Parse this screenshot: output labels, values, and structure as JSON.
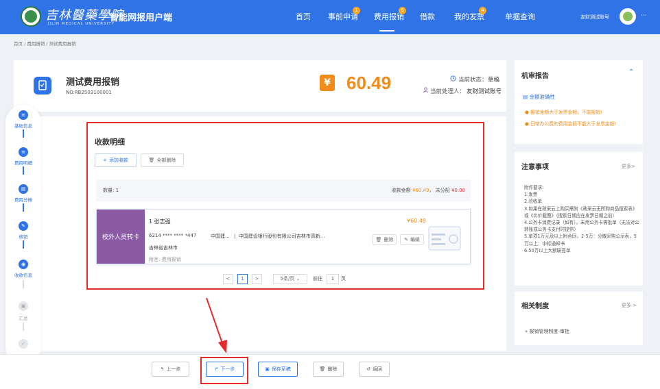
{
  "header": {
    "brand_cn": "吉林醫藥學院",
    "brand_en": "JILIN MEDICAL UNIVERSITY",
    "app_title": "智能网报用户端",
    "nav": [
      {
        "label": "首页",
        "badge": ""
      },
      {
        "label": "事前申请",
        "badge": "1"
      },
      {
        "label": "费用报销",
        "badge": "6"
      },
      {
        "label": "借款",
        "badge": ""
      },
      {
        "label": "我的发票",
        "badge": "4"
      },
      {
        "label": "单据查询",
        "badge": ""
      }
    ],
    "user_name": "友财测试账号",
    "more": "···"
  },
  "breadcrumb": "首页 / 费用报销 / 测试费用报销",
  "document": {
    "title": "测试费用报销",
    "number": "NO.RB2503100001",
    "amount": "60.49",
    "amount_icon": "¥",
    "status_label": "当前状态：",
    "status_value": "草稿",
    "handler_label": "当前处理人：",
    "handler_value": "友财测试账号"
  },
  "steps": [
    {
      "label": "基础信息",
      "active": true,
      "icon": "doc-icon"
    },
    {
      "label": "费用明细",
      "active": true,
      "icon": "list-icon"
    },
    {
      "label": "费用分摊",
      "active": true,
      "icon": "split-icon"
    },
    {
      "label": "核销",
      "active": true,
      "icon": "verify-icon"
    },
    {
      "label": "收款信息",
      "active": true,
      "icon": "payee-icon"
    },
    {
      "label": "汇总",
      "active": false,
      "icon": "summary-icon"
    },
    {
      "label": "完成",
      "active": false,
      "icon": "check-icon"
    }
  ],
  "payee_section": {
    "title": "收款明细",
    "add_button": "添加收款",
    "delete_all_button": "全部删除",
    "count_text": "数量: 1",
    "summary_amount_label": "收款金额",
    "summary_amount": "¥60.49",
    "unallocated_label": "未分配",
    "unallocated_amount": "¥0.00",
    "card": {
      "stamp": "校外人员转卡",
      "index_name": "1  张志强",
      "account": "6214 **** **** *447",
      "bank_short": "中国建...",
      "bank_full": "中国建设银行股份有限公司吉林市高新...",
      "city": "吉林省吉林市",
      "note": "附言: 费用报销",
      "amount": "¥60.49",
      "delete_label": "删除",
      "edit_label": "编辑"
    },
    "pager": {
      "prev": "<",
      "page": "1",
      "next": ">",
      "page_size": "5条/页",
      "goto_label": "前往",
      "goto_value": "1",
      "page_suffix": "页"
    }
  },
  "audit_report": {
    "title": "机审报告",
    "subtitle": "金额准确性",
    "warnings": [
      "报销金额大于发票金额，不能报销!",
      "日常办公费的费用金额不能大于发票金额!"
    ]
  },
  "notice": {
    "title": "注意事项",
    "more": "更多>",
    "lines": [
      "附件要求:",
      "1.发票",
      "2.验收单",
      "3.如果在政采云上购买需附《政采云无所购商品搜索表》或《比价截图》（搜索日期应在发票日期之前）",
      "4.公务卡消费记录（如有），未用公务卡需批单（无法对公转账或公务卡支付时提供）",
      "5.单项1万元及以上附合同，2-5万：分散采购公示表，5万以上：中标通知书",
      "6.50万以上大额联签单"
    ]
  },
  "policy": {
    "title": "相关制度",
    "more": "更多 >",
    "items": [
      "报销管理制度-审批"
    ]
  },
  "footer": {
    "prev": "上一步",
    "next": "下一步",
    "save": "保存草稿",
    "delete": "删除",
    "back": "返回"
  },
  "colors": {
    "primary": "#2f73e6",
    "accent": "#f08c1a",
    "annotation": "#e62b2b",
    "stamp": "#8a5aa4"
  }
}
